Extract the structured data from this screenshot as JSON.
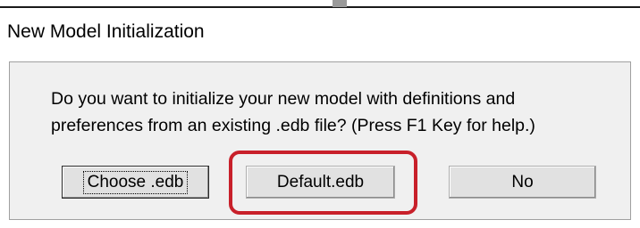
{
  "dialog": {
    "title": "New Model Initialization",
    "message_lines": [
      "Do you want to initialize your new model with definitions and",
      "preferences from an existing .edb file? (Press F1 Key for help.)"
    ],
    "buttons": {
      "choose": "Choose .edb",
      "default": "Default.edb",
      "no": "No"
    },
    "focused_button": "Choose .edb",
    "highlighted_button": "Default.edb",
    "highlight_color": "#c8202a"
  }
}
